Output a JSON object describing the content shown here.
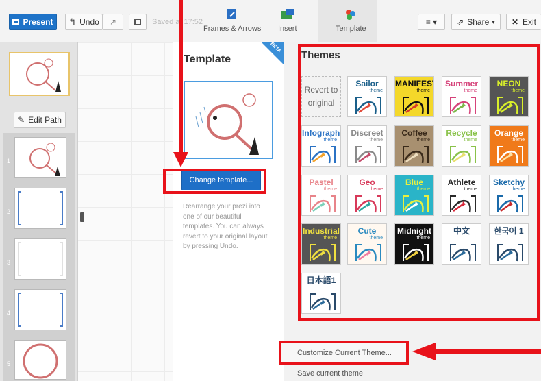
{
  "toolbar": {
    "present": "Present",
    "undo": "Undo",
    "saved": "Saved at 17:52",
    "frames": "Frames & Arrows",
    "insert": "Insert",
    "template": "Template",
    "share": "Share",
    "exit": "Exit"
  },
  "sidebar": {
    "edit_path": "Edit Path",
    "slides": [
      "1",
      "2",
      "3",
      "4",
      "5"
    ]
  },
  "template_panel": {
    "title": "Template",
    "beta": "BETA",
    "change_button": "Change template...",
    "description": "Rearrange your prezi into one of our beautiful templates. You can always revert to your original layout by pressing Undo."
  },
  "themes": {
    "title": "Themes",
    "revert": "Revert to original",
    "items": [
      {
        "name": "Sailor",
        "sub": "theme",
        "bg": "#ffffff",
        "fg": "#1a5f8a",
        "accent": "#e24b3a"
      },
      {
        "name": "MANIFESTO",
        "sub": "theme",
        "bg": "#f4d82a",
        "fg": "#111111",
        "accent": "#d83a2a"
      },
      {
        "name": "Summer",
        "sub": "theme",
        "bg": "#ffffff",
        "fg": "#d6437a",
        "accent": "#7bb84a"
      },
      {
        "name": "NEON",
        "sub": "theme",
        "bg": "#555555",
        "fg": "#d9f02a",
        "accent": "#d9f02a"
      },
      {
        "name": "Infographic",
        "sub": "theme",
        "bg": "#ffffff",
        "fg": "#2a72c4",
        "accent": "#f2a12a"
      },
      {
        "name": "Discreet",
        "sub": "theme",
        "bg": "#ffffff",
        "fg": "#8a8a8a",
        "accent": "#c44a6a"
      },
      {
        "name": "Coffee",
        "sub": "theme",
        "bg": "#a89070",
        "fg": "#3a2a1a",
        "accent": "#f0e0c0"
      },
      {
        "name": "Recycle",
        "sub": "theme",
        "bg": "#ffffff",
        "fg": "#8ac24a",
        "accent": "#e8e070"
      },
      {
        "name": "Orange",
        "sub": "theme",
        "bg": "#f07a1a",
        "fg": "#ffffff",
        "accent": "#ffe0a0"
      },
      {
        "name": "Pastel",
        "sub": "theme",
        "bg": "#ffffff",
        "fg": "#e8848a",
        "accent": "#7ad0b8"
      },
      {
        "name": "Geo",
        "sub": "theme",
        "bg": "#ffffff",
        "fg": "#d83a5a",
        "accent": "#2aa8a0"
      },
      {
        "name": "Blue",
        "sub": "theme",
        "bg": "#2ab4c8",
        "fg": "#e8f040",
        "accent": "#ffffff"
      },
      {
        "name": "Athlete",
        "sub": "theme",
        "bg": "#ffffff",
        "fg": "#2a2a2a",
        "accent": "#d8283a"
      },
      {
        "name": "Sketchy",
        "sub": "theme",
        "bg": "#ffffff",
        "fg": "#1a6aaa",
        "accent": "#c82a2a"
      },
      {
        "name": "Industrial",
        "sub": "theme",
        "bg": "#555555",
        "fg": "#f0e040",
        "accent": "#f0e040"
      },
      {
        "name": "Cute",
        "sub": "theme",
        "bg": "#fff8f0",
        "fg": "#2a8ac0",
        "accent": "#f07aa0"
      },
      {
        "name": "Midnight",
        "sub": "theme",
        "bg": "#111111",
        "fg": "#ffffff",
        "accent": "#f0d040"
      },
      {
        "name": "中文",
        "sub": "",
        "bg": "#ffffff",
        "fg": "#2a4a6a",
        "accent": "#2a6a9a"
      },
      {
        "name": "한국어 1",
        "sub": "",
        "bg": "#ffffff",
        "fg": "#2a4a6a",
        "accent": "#2a6a9a"
      },
      {
        "name": "日本語1",
        "sub": "",
        "bg": "#ffffff",
        "fg": "#2a4a6a",
        "accent": "#2a6a9a"
      }
    ]
  },
  "customize": "Customize Current Theme...",
  "save_theme": "Save current theme"
}
